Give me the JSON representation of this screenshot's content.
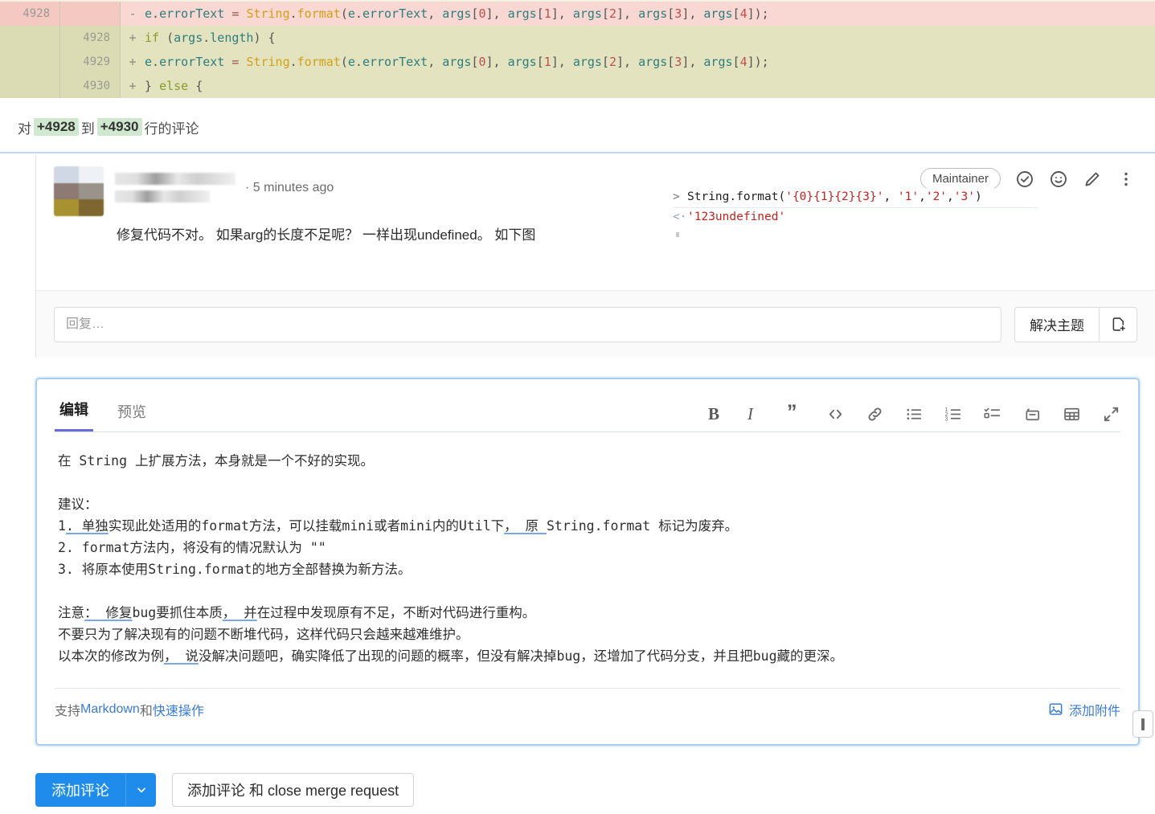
{
  "diff": {
    "rows": [
      {
        "old_line": "4928",
        "new_line": "",
        "sign": "-",
        "type": "removed",
        "code": "        e.errorText = String.format(e.errorText, args[0], args[1], args[2], args[3], args[4]);"
      },
      {
        "old_line": "",
        "new_line": "4928",
        "sign": "+",
        "type": "added",
        "code": "        if (args.length) {"
      },
      {
        "old_line": "",
        "new_line": "4929",
        "sign": "+",
        "type": "added",
        "code": "            e.errorText = String.format(e.errorText, args[0], args[1], args[2], args[3], args[4]);"
      },
      {
        "old_line": "",
        "new_line": "4930",
        "sign": "+",
        "type": "added",
        "code": "        } else {"
      }
    ],
    "colors": {
      "removed_bg": "#f9d7d2",
      "added_bg": "#e3e3c0"
    }
  },
  "comment_header": {
    "prefix": "对",
    "line_from": "+4928",
    "middle": "到",
    "line_to": "+4930",
    "suffix": "行的评论"
  },
  "note": {
    "author_redacted": true,
    "timestamp": "· 5 minutes ago",
    "badge": "Maintainer",
    "body_text": "修复代码不对。 如果arg的长度不足呢？ 一样出现undefined。 如下图",
    "actions": {
      "resolve_icon": "check-circle-icon",
      "emoji_icon": "smiley-icon",
      "edit_icon": "pencil-icon",
      "more_icon": "ellipsis-vertical-icon"
    },
    "console_screenshot": {
      "input_prompt": ">",
      "input_code": "String.format('{0}{1}{2}{3}', '1','2','3')",
      "output_prompt": "<·",
      "output_value": "'123undefined'"
    }
  },
  "reply": {
    "placeholder": "回复…",
    "value": "",
    "resolve_label": "解决主题",
    "new_issue_icon": "new-issue-icon"
  },
  "editor": {
    "tabs": [
      {
        "label": "编辑",
        "active": true
      },
      {
        "label": "预览",
        "active": false
      }
    ],
    "toolbar": [
      {
        "name": "bold",
        "glyph": "B"
      },
      {
        "name": "italic",
        "glyph": "I"
      },
      {
        "name": "quote",
        "glyph": "”"
      },
      {
        "name": "code",
        "glyph": "</>"
      },
      {
        "name": "link",
        "glyph": "link"
      },
      {
        "name": "bullet-list",
        "glyph": "ul"
      },
      {
        "name": "numbered-list",
        "glyph": "ol"
      },
      {
        "name": "task-list",
        "glyph": "task"
      },
      {
        "name": "collapsible-section",
        "glyph": "details"
      },
      {
        "name": "table",
        "glyph": "table"
      },
      {
        "name": "fullscreen",
        "glyph": "expand"
      }
    ],
    "content_lines": [
      "在 String 上扩展方法，本身就是一个不好的实现。",
      "",
      "建议：",
      "1. 单独实现此处适用的format方法，可以挂载mini或者mini内的Util下， 原 String.format 标记为废弃。",
      "2. format方法内，将没有的情况默认为 \"\"",
      "3. 将原本使用String.format的地方全部替换为新方法。",
      "",
      "注意： 修复bug要抓住本质， 并在过程中发现原有不足，不断对代码进行重构。",
      "不要只为了解决现有的问题不断堆代码，这样代码只会越来越难维护。",
      "以本次的修改为例， 说没解决问题吧，确实降低了出现的问题的概率，但没有解决掉bug，还增加了代码分支，并且把bug藏的更深。"
    ],
    "footer": {
      "support_prefix": "支持",
      "markdown_link": "Markdown",
      "and_text": "和",
      "quickactions_link": "快速操作",
      "attach_label": "添加附件",
      "attach_icon": "image-icon"
    }
  },
  "actions": {
    "primary_label": "添加评论",
    "dropdown_icon": "chevron-down-icon",
    "secondary_label": "添加评论 和 close merge request"
  },
  "colors": {
    "accent_blue": "#1f8ceb",
    "link_blue": "#3a7bd5",
    "tab_underline": "#6b6bd6",
    "focus_border": "#a8cdf0",
    "highlight_green": "#cfe8cf"
  }
}
